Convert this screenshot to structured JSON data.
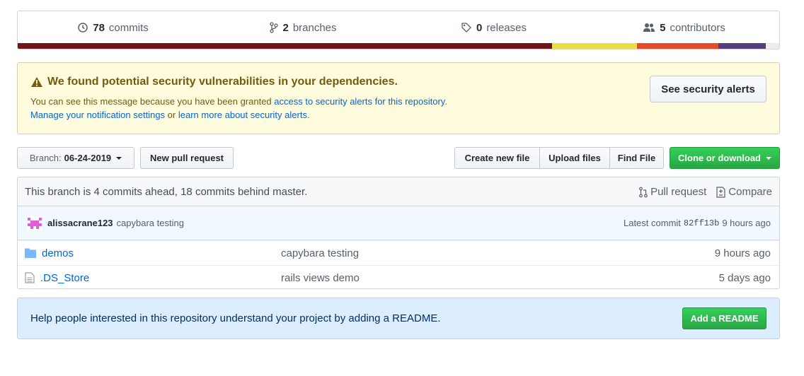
{
  "summary": {
    "commits_count": "78",
    "commits_label": "commits",
    "branches_count": "2",
    "branches_label": "branches",
    "releases_count": "0",
    "releases_label": "releases",
    "contributors_count": "5",
    "contributors_label": "contributors",
    "languages": [
      {
        "color": "#701516",
        "fraction": 0.702
      },
      {
        "color": "#e7e145",
        "fraction": 0.111
      },
      {
        "color": "#e34c26",
        "fraction": 0.107
      },
      {
        "color": "#563d7c",
        "fraction": 0.062
      },
      {
        "color": "#ededed",
        "fraction": 0.018
      }
    ]
  },
  "alert": {
    "title": "We found potential security vulnerabilities in your dependencies.",
    "line1_prefix": "You can see this message because you have been granted ",
    "line1_link": "access to security alerts for this repository",
    "line1_suffix": ".",
    "line2_link1": "Manage your notification settings",
    "line2_mid": " or ",
    "line2_link2": "learn more about security alerts",
    "line2_suffix": ".",
    "button": "See security alerts"
  },
  "toolbar": {
    "branch_prefix": "Branch: ",
    "branch_name": "06-24-2019",
    "new_pr": "New pull request",
    "create_file": "Create new file",
    "upload_files": "Upload files",
    "find_file": "Find File",
    "clone": "Clone or download"
  },
  "branch_info": {
    "text": "This branch is 4 commits ahead, 18 commits behind master.",
    "pull_request": "Pull request",
    "compare": "Compare"
  },
  "latest_commit": {
    "author": "alissacrane123",
    "message": "capybara testing",
    "label": "Latest commit",
    "sha": "82ff13b",
    "age": "9 hours ago"
  },
  "files": [
    {
      "icon": "folder-icon",
      "name": "demos",
      "message": "capybara testing",
      "age": "9 hours ago"
    },
    {
      "icon": "file-icon",
      "name": ".DS_Store",
      "message": "rails views demo",
      "age": "5 days ago"
    }
  ],
  "readme": {
    "text": "Help people interested in this repository understand your project by adding a README.",
    "button": "Add a README"
  },
  "colors": {
    "green": "#28a745",
    "link": "#0366d6",
    "warning_bg": "#fffbdd",
    "info_bg": "#dbedff"
  }
}
